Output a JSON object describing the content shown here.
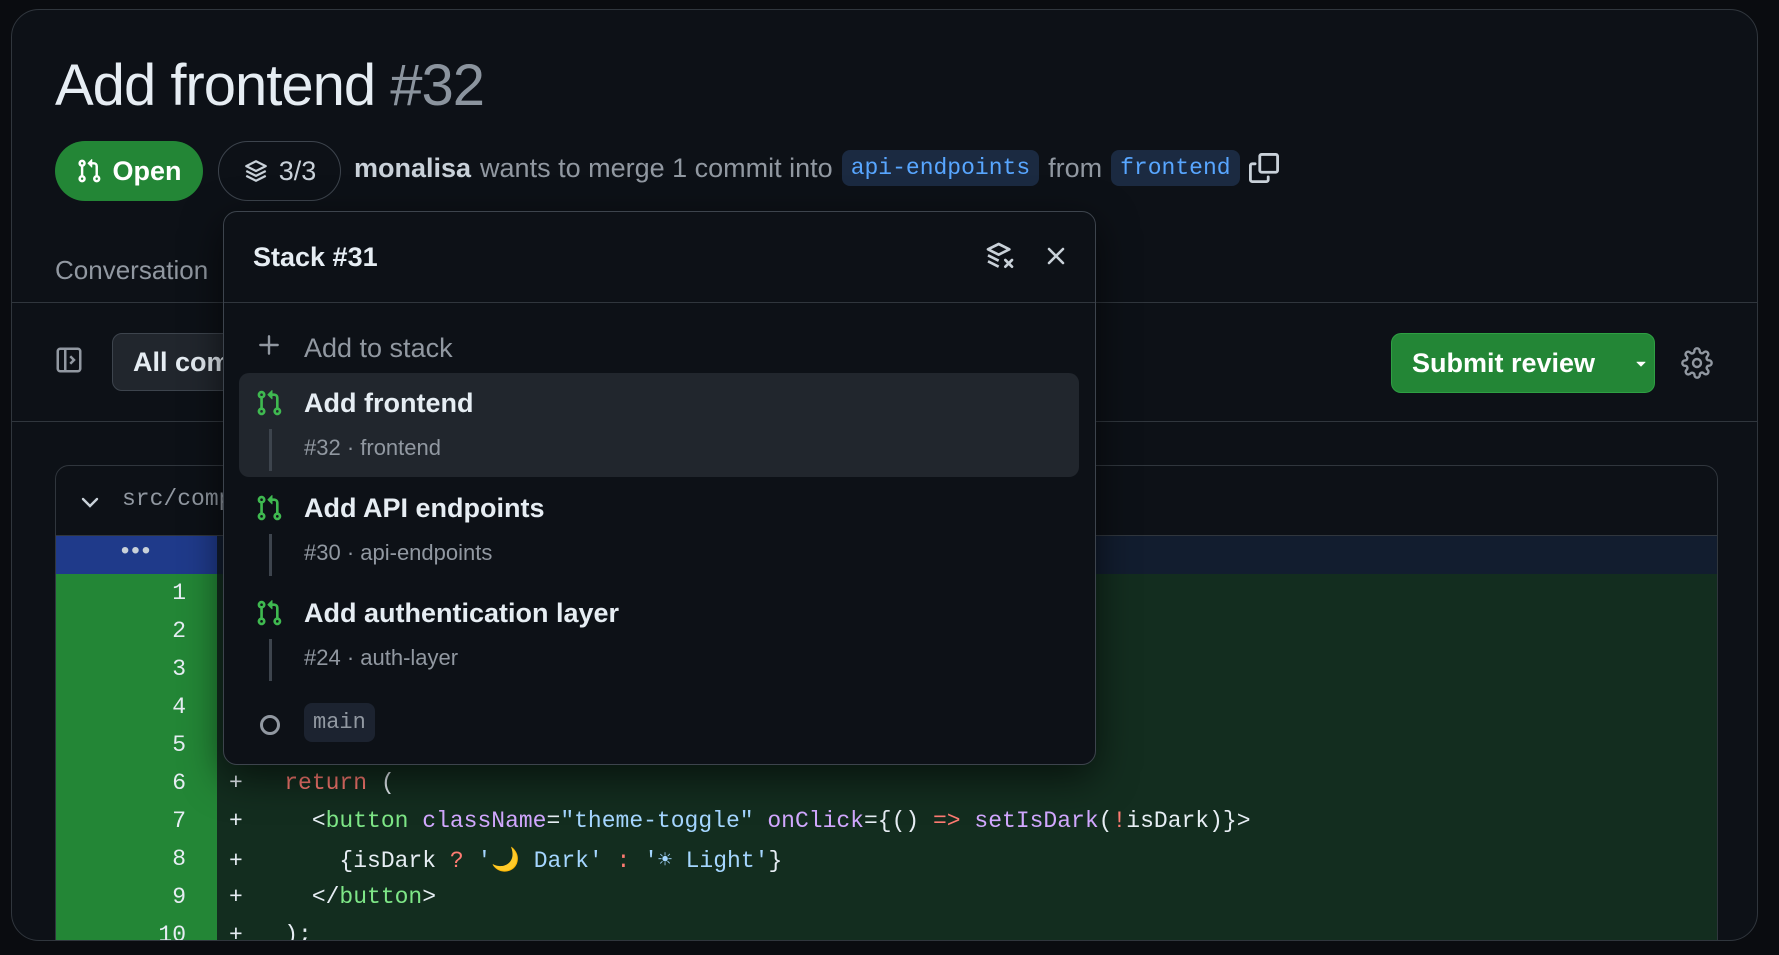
{
  "header": {
    "title": "Add frontend",
    "number": "#32"
  },
  "status": {
    "label": "Open",
    "stack_count": "3/3"
  },
  "meta": {
    "author": "monalisa",
    "text": "wants to merge 1 commit into",
    "base": "api-endpoints",
    "from": "from",
    "head": "frontend"
  },
  "tabs": {
    "conversation": "Conversation"
  },
  "toolbar": {
    "filter_label": "All commits",
    "submit_label": "Submit review"
  },
  "file": {
    "path": "src/components/ThemeToggle.jsx",
    "hunk": "•••"
  },
  "lines": [
    "1",
    "2",
    "3",
    "4",
    "5",
    "6",
    "7",
    "8",
    "9",
    "10"
  ],
  "popover": {
    "title": "Stack #31",
    "add_label": "Add to stack",
    "items": [
      {
        "title": "Add frontend",
        "sub": "#32 · frontend"
      },
      {
        "title": "Add API endpoints",
        "sub": "#30 · api-endpoints"
      },
      {
        "title": "Add authentication layer",
        "sub": "#24 · auth-layer"
      }
    ],
    "base_branch": "main"
  },
  "colors": {
    "accent_green": "#238636",
    "link_blue": "#58a6ff",
    "active_indicator": "#4493f8",
    "diff_add_bg": "#132d1f"
  }
}
